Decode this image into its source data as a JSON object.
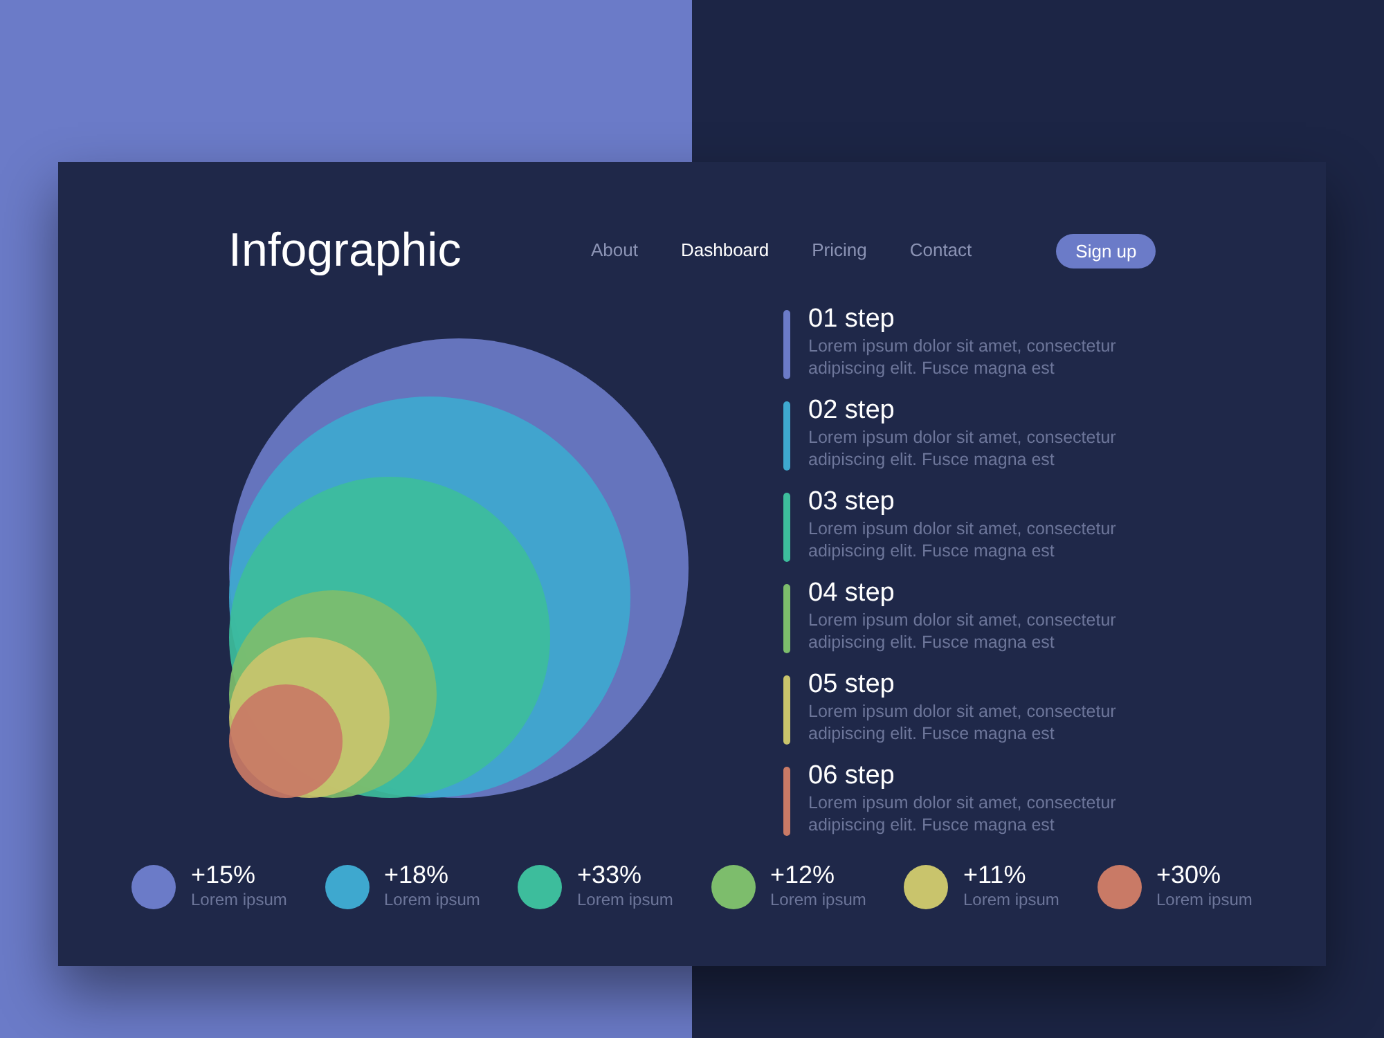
{
  "header": {
    "title": "Infographic",
    "nav": [
      {
        "label": "About",
        "selected": false
      },
      {
        "label": "Dashboard",
        "selected": true
      },
      {
        "label": "Pricing",
        "selected": false
      },
      {
        "label": "Contact",
        "selected": false
      }
    ],
    "signup": "Sign up"
  },
  "steps": [
    {
      "title": "01 step",
      "text": "Lorem ipsum dolor sit amet, consectetur adipiscing elit. Fusce magna est",
      "color": "#6b7bc8"
    },
    {
      "title": "02 step",
      "text": "Lorem ipsum dolor sit amet, consectetur adipiscing elit. Fusce magna est",
      "color": "#3ea8cf"
    },
    {
      "title": "03 step",
      "text": "Lorem ipsum dolor sit amet, consectetur adipiscing elit. Fusce magna est",
      "color": "#3dbd9c"
    },
    {
      "title": "04 step",
      "text": "Lorem ipsum dolor sit amet, consectetur adipiscing elit. Fusce magna est",
      "color": "#7dbd6c"
    },
    {
      "title": "05 step",
      "text": "Lorem ipsum dolor sit amet, consectetur adipiscing elit. Fusce magna est",
      "color": "#c9c46c"
    },
    {
      "title": "06 step",
      "text": "Lorem ipsum dolor sit amet, consectetur adipiscing elit. Fusce magna est",
      "color": "#c97a66"
    }
  ],
  "legend": [
    {
      "value": "+15%",
      "label": "Lorem ipsum",
      "color": "#6b7bc8"
    },
    {
      "value": "+18%",
      "label": "Lorem ipsum",
      "color": "#3ea8cf"
    },
    {
      "value": "+33%",
      "label": "Lorem ipsum",
      "color": "#3dbd9c"
    },
    {
      "value": "+12%",
      "label": "Lorem ipsum",
      "color": "#7dbd6c"
    },
    {
      "value": "+11%",
      "label": "Lorem ipsum",
      "color": "#c9c46c"
    },
    {
      "value": "+30%",
      "label": "Lorem ipsum",
      "color": "#c97a66"
    }
  ]
}
